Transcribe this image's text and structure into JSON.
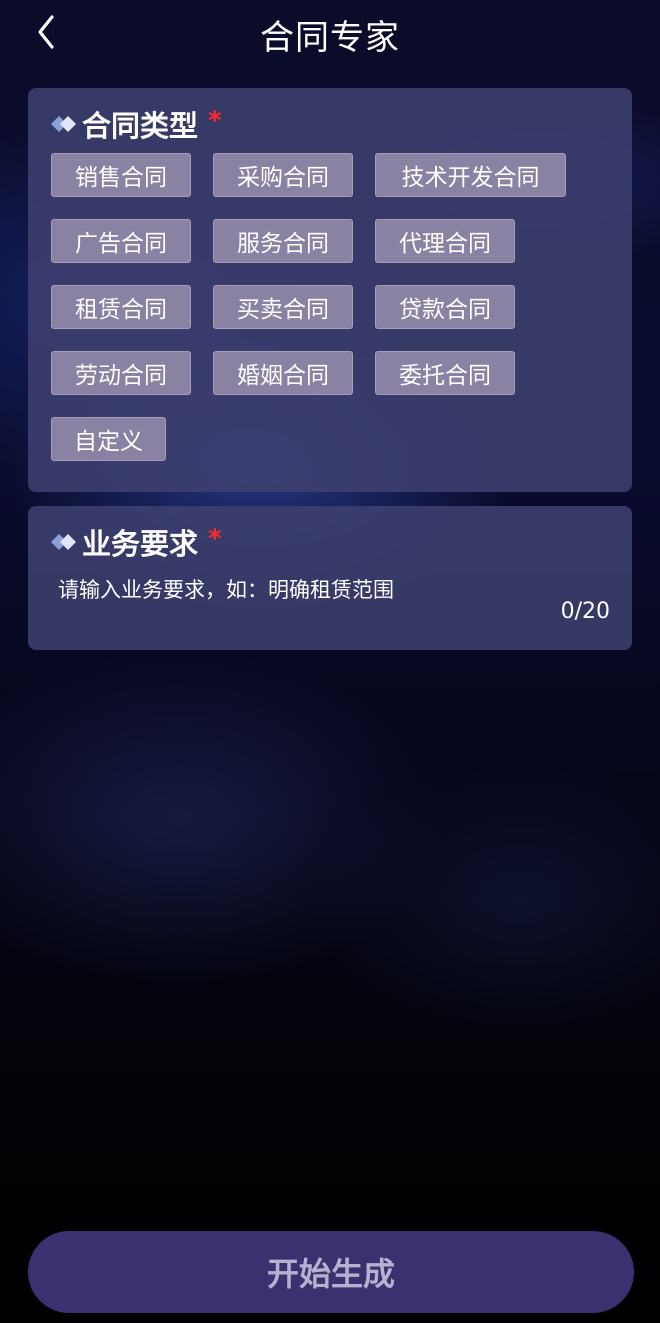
{
  "header": {
    "title": "合同专家",
    "back_icon": "chevron-left-icon"
  },
  "contract_type": {
    "label": "合同类型",
    "required_mark": "*",
    "options": [
      {
        "label": "销售合同"
      },
      {
        "label": "采购合同"
      },
      {
        "label": "技术开发合同"
      },
      {
        "label": "广告合同"
      },
      {
        "label": "服务合同"
      },
      {
        "label": "代理合同"
      },
      {
        "label": "租赁合同"
      },
      {
        "label": "买卖合同"
      },
      {
        "label": "贷款合同"
      },
      {
        "label": "劳动合同"
      },
      {
        "label": "婚姻合同"
      },
      {
        "label": "委托合同"
      },
      {
        "label": "自定义"
      }
    ]
  },
  "requirements": {
    "label": "业务要求",
    "required_mark": "*",
    "placeholder": "请输入业务要求，如：明确租赁范围",
    "value": "",
    "counter": "0/20"
  },
  "generate_button": {
    "label": "开始生成"
  },
  "colors": {
    "accent": "#3b3070",
    "required": "#ff2a2a",
    "card": "#3e406e",
    "chip": "#8a82a2"
  }
}
